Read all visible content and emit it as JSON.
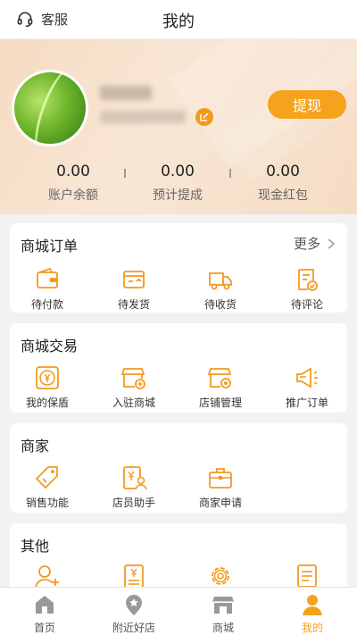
{
  "topbar": {
    "customer_service": "客服",
    "title": "我的"
  },
  "header": {
    "withdraw_label": "提现",
    "stats": [
      {
        "value": "0.00",
        "label": "账户余额"
      },
      {
        "value": "0.00",
        "label": "预计提成"
      },
      {
        "value": "0.00",
        "label": "现金红包"
      }
    ]
  },
  "sections": {
    "orders": {
      "title": "商城订单",
      "more": "更多",
      "items": [
        {
          "label": "待付款",
          "icon": "wallet-icon"
        },
        {
          "label": "待发货",
          "icon": "card-icon"
        },
        {
          "label": "待收货",
          "icon": "truck-icon"
        },
        {
          "label": "待评论",
          "icon": "review-icon"
        }
      ]
    },
    "trade": {
      "title": "商城交易",
      "items": [
        {
          "label": "我的保盾",
          "icon": "yen-shield-icon"
        },
        {
          "label": "入驻商城",
          "icon": "store-add-icon"
        },
        {
          "label": "店铺管理",
          "icon": "store-manage-icon"
        },
        {
          "label": "推广订单",
          "icon": "megaphone-icon"
        }
      ]
    },
    "merchant": {
      "title": "商家",
      "items": [
        {
          "label": "销售功能",
          "icon": "tag-icon"
        },
        {
          "label": "店员助手",
          "icon": "clerk-icon"
        },
        {
          "label": "商家申请",
          "icon": "briefcase-icon"
        }
      ]
    },
    "other": {
      "title": "其他",
      "items": [
        {
          "label": "",
          "icon": "add-user-icon"
        },
        {
          "label": "",
          "icon": "yen-doc-icon"
        },
        {
          "label": "",
          "icon": "gear-icon"
        },
        {
          "label": "",
          "icon": "list-icon"
        }
      ]
    }
  },
  "bottomnav": [
    {
      "label": "首页",
      "icon": "home-icon"
    },
    {
      "label": "附近好店",
      "icon": "location-star-icon"
    },
    {
      "label": "商城",
      "icon": "store-icon"
    },
    {
      "label": "我的",
      "icon": "user-icon",
      "active": true
    }
  ],
  "colors": {
    "accent": "#f5a31c",
    "icon_orange": "#f39a1e"
  }
}
